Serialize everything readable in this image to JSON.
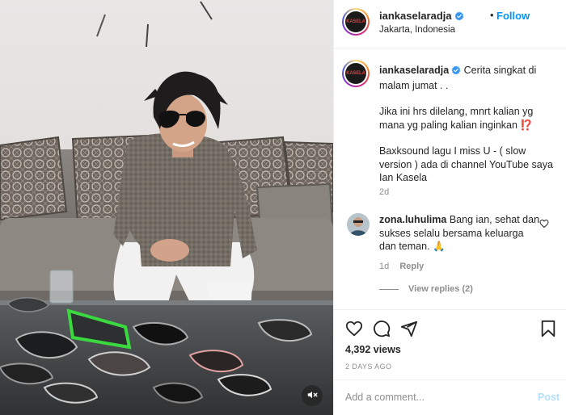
{
  "post": {
    "username": "iankaselaradja",
    "follow_label": "Follow",
    "separator": "•",
    "location": "Jakarta, Indonesia",
    "avatar_text": "KASELA",
    "accent_color": "#0095f6",
    "verified_color": "#3897f0"
  },
  "caption": {
    "username": "iankaselaradja",
    "line1": "Cerita singkat di malam jumat . .",
    "line2": "Jika ini hrs dilelang, mnrt kalian yg mana yg paling kalian inginkan ⁉️",
    "line3": "Baxksound lagu I miss U - ( slow version ) ada di channel YouTube saya Ian Kasela",
    "time": "2d"
  },
  "comments": [
    {
      "username": "zona.luhulima",
      "text": "Bang ian, sehat dan sukses selalu bersama keluarga dan teman. 🙏",
      "time": "1d",
      "reply_label": "Reply",
      "view_replies_label": "View replies (2)"
    }
  ],
  "actions": {
    "like_icon": "heart-icon",
    "comment_icon": "comment-icon",
    "share_icon": "share-icon",
    "save_icon": "bookmark-icon"
  },
  "stats": {
    "views": "4,392 views",
    "posted": "2 DAYS AGO"
  },
  "add_comment": {
    "placeholder": "Add a comment...",
    "post_label": "Post"
  },
  "media": {
    "mute_icon": "speaker-muted-icon"
  }
}
